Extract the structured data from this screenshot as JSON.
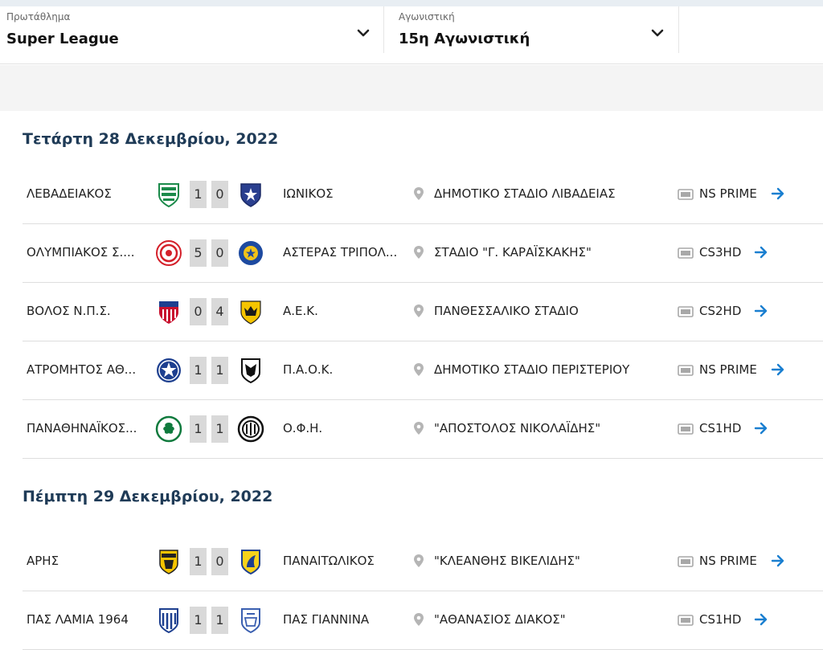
{
  "filters": {
    "league": {
      "label": "Πρωτάθλημα",
      "value": "Super League"
    },
    "round": {
      "label": "Αγωνιστική",
      "value": "15η Αγωνιστική"
    }
  },
  "colors": {
    "accent": "#1a7fd0",
    "heading": "#1f3b57",
    "score_bg": "#d9d9d9"
  },
  "days": [
    {
      "title": "Τετάρτη 28 Δεκεμβρίου, 2022",
      "matches": [
        {
          "home": "ΛΕΒΑΔΕΙΑΚΟΣ",
          "home_score": "1",
          "away_score": "0",
          "away": "ΙΩΝΙΚΟΣ",
          "venue": "ΔΗΜΟΤΙΚΟ ΣΤΑΔΙΟ ΛΙΒΑΔΕΙΑΣ",
          "channel": "NS PRIME",
          "home_crest": "levadiakos-crest",
          "away_crest": "ionikos-crest"
        },
        {
          "home": "ΟΛΥΜΠΙΑΚΟΣ Σ....",
          "home_score": "5",
          "away_score": "0",
          "away": "ΑΣΤΕΡΑΣ ΤΡΙΠΟΛ...",
          "venue": "ΣΤΑΔΙΟ \"Γ. ΚΑΡΑΪΣΚΑΚΗΣ\"",
          "channel": "CS3HD",
          "home_crest": "olympiakos-crest",
          "away_crest": "asteras-crest"
        },
        {
          "home": "ΒΟΛΟΣ Ν.Π.Σ.",
          "home_score": "0",
          "away_score": "4",
          "away": "Α.Ε.Κ.",
          "venue": "ΠΑΝΘΕΣΣΑΛΙΚΟ ΣΤΑΔΙΟ",
          "channel": "CS2HD",
          "home_crest": "volos-crest",
          "away_crest": "aek-crest"
        },
        {
          "home": "ΑΤΡΟΜΗΤΟΣ ΑΘ...",
          "home_score": "1",
          "away_score": "1",
          "away": "Π.Α.Ο.Κ.",
          "venue": "ΔΗΜΟΤΙΚΟ ΣΤΑΔΙΟ ΠΕΡΙΣΤΕΡΙΟΥ",
          "channel": "NS PRIME",
          "home_crest": "atromitos-crest",
          "away_crest": "paok-crest"
        },
        {
          "home": "ΠΑΝΑΘΗΝΑΪΚΟΣ...",
          "home_score": "1",
          "away_score": "1",
          "away": "Ο.Φ.Η.",
          "venue": "\"ΑΠΟΣΤΟΛΟΣ ΝΙΚΟΛΑΪΔΗΣ\"",
          "channel": "CS1HD",
          "home_crest": "panathinaikos-crest",
          "away_crest": "ofi-crest"
        }
      ]
    },
    {
      "title": "Πέμπτη 29 Δεκεμβρίου, 2022",
      "matches": [
        {
          "home": "ΑΡΗΣ",
          "home_score": "1",
          "away_score": "0",
          "away": "ΠΑΝΑΙΤΩΛΙΚΟΣ",
          "venue": "\"ΚΛΕΑΝΘΗΣ ΒΙΚΕΛΙΔΗΣ\"",
          "channel": "NS PRIME",
          "home_crest": "aris-crest",
          "away_crest": "panetolikos-crest"
        },
        {
          "home": "ΠΑΣ ΛΑΜΙΑ 1964",
          "home_score": "1",
          "away_score": "1",
          "away": "ΠΑΣ ΓΙΑΝΝΙΝΑ",
          "venue": "\"ΑΘΑΝΑΣΙΟΣ ΔΙΑΚΟΣ\"",
          "channel": "CS1HD",
          "home_crest": "lamia-crest",
          "away_crest": "giannina-crest"
        }
      ]
    }
  ]
}
